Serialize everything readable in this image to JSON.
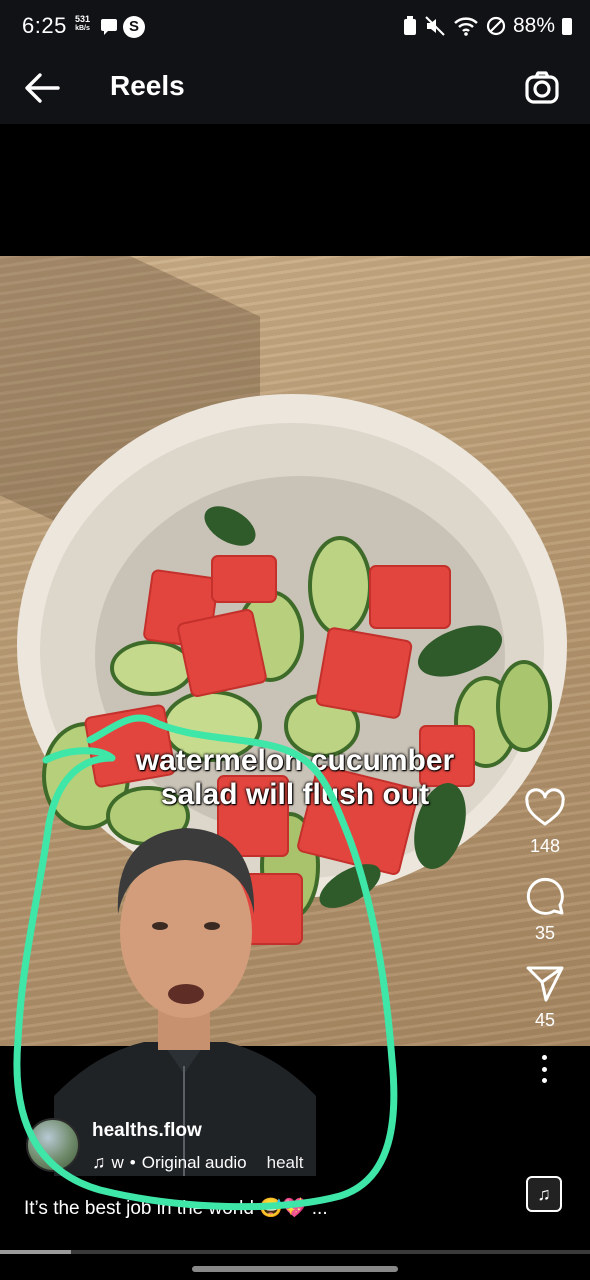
{
  "status_bar": {
    "time": "6:25",
    "net_speed_value": "531",
    "net_speed_unit": "kB/s",
    "battery": "88%",
    "s_badge": "S"
  },
  "header": {
    "title": "Reels"
  },
  "video": {
    "overlay_caption_line1": "watermelon cucumber",
    "overlay_caption_line2": "salad will flush out"
  },
  "actions": {
    "likes": "148",
    "comments": "35",
    "shares": "45"
  },
  "post": {
    "username": "healths.flow",
    "audio_user": "w",
    "audio_separator": "•",
    "audio_label": "Original audio",
    "audio_extra": "healt",
    "caption": "It’s the best job in the world 😅💖 ..."
  },
  "playback": {
    "progress": 0.12
  },
  "colors": {
    "annotation": "#3ee6a8",
    "bar_bg": "#101216"
  }
}
